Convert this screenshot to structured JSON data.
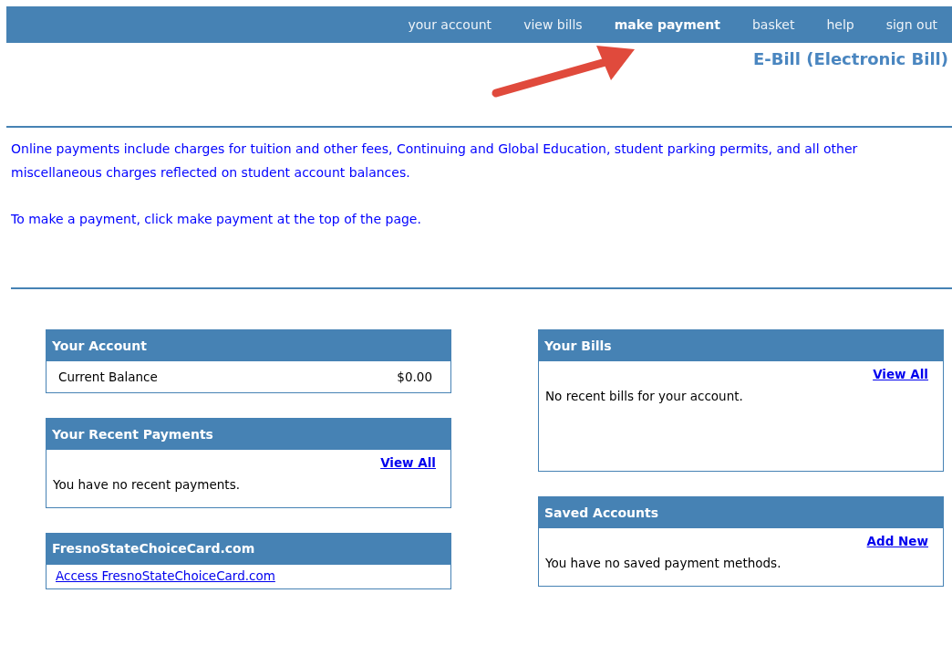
{
  "nav": [
    {
      "label": "your account",
      "selected": false
    },
    {
      "label": "view bills",
      "selected": false
    },
    {
      "label": "make payment",
      "selected": true
    },
    {
      "label": "basket",
      "selected": false
    },
    {
      "label": "help",
      "selected": false
    },
    {
      "label": "sign out",
      "selected": false
    }
  ],
  "page_title": "E-Bill (Electronic Bill)",
  "intro": [
    "Online payments include charges for tuition and other fees, Continuing and Global Education, student parking permits, and all other miscellaneous charges reflected on student account balances.",
    "To make a payment, click make payment at the top of the page."
  ],
  "left_panels": [
    {
      "kind": "balance",
      "title": "Your Account",
      "label": "Current Balance",
      "value": "$0.00"
    },
    {
      "kind": "message",
      "title": "Your Recent Payments",
      "link": "View All",
      "message": "You have no recent payments."
    },
    {
      "kind": "link",
      "title": "FresnoStateChoiceCard.com",
      "link": "Access FresnoStateChoiceCard.com"
    }
  ],
  "right_panels": [
    {
      "kind": "tall_message",
      "title": "Your Bills",
      "link": "View All",
      "message": "No recent bills for your account."
    },
    {
      "kind": "message",
      "title": "Saved Accounts",
      "link": "Add New",
      "message": "You have no saved payment methods."
    }
  ]
}
